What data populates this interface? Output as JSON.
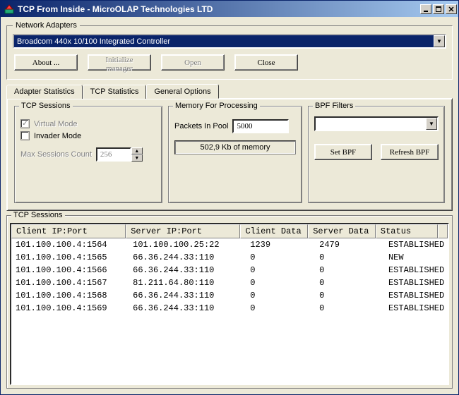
{
  "window": {
    "title": "TCP From Inside - MicroOLAP Technologies LTD"
  },
  "adapters": {
    "legend": "Network Adapters",
    "selected": "Broadcom 440x 10/100 Integrated Controller"
  },
  "buttons": {
    "about": "About ...",
    "init": "Initialize manager",
    "open": "Open",
    "close": "Close"
  },
  "tabs": {
    "adapter": "Adapter Statistics",
    "tcp": "TCP Statistics",
    "general": "General Options"
  },
  "tcpSessionsGroup": {
    "legend": "TCP Sessions",
    "virtualMode": "Virtual Mode",
    "invaderMode": "Invader Mode",
    "maxSessionsLabel": "Max Sessions Count",
    "maxSessionsValue": "256"
  },
  "memoryGroup": {
    "legend": "Memory For Processing",
    "packetsLabel": "Packets In Pool",
    "packetsValue": "5000",
    "memoryText": "502,9 Kb of memory"
  },
  "bpfGroup": {
    "legend": "BPF Filters",
    "selected": "",
    "setBpf": "Set BPF",
    "refreshBpf": "Refresh BPF"
  },
  "sessions": {
    "legend": "TCP Sessions",
    "columns": [
      "Client IP:Port",
      "Server IP:Port",
      "Client Data",
      "Server Data",
      "Status"
    ],
    "rows": [
      {
        "client": "101.100.100.4:1564",
        "server": "101.100.100.25:22",
        "cdata": "1239",
        "sdata": "2479",
        "status": "ESTABLISHED"
      },
      {
        "client": "101.100.100.4:1565",
        "server": "66.36.244.33:110",
        "cdata": "0",
        "sdata": "0",
        "status": "NEW"
      },
      {
        "client": "101.100.100.4:1566",
        "server": "66.36.244.33:110",
        "cdata": "0",
        "sdata": "0",
        "status": "ESTABLISHED"
      },
      {
        "client": "101.100.100.4:1567",
        "server": "81.211.64.80:110",
        "cdata": "0",
        "sdata": "0",
        "status": "ESTABLISHED"
      },
      {
        "client": "101.100.100.4:1568",
        "server": "66.36.244.33:110",
        "cdata": "0",
        "sdata": "0",
        "status": "ESTABLISHED"
      },
      {
        "client": "101.100.100.4:1569",
        "server": "66.36.244.33:110",
        "cdata": "0",
        "sdata": "0",
        "status": "ESTABLISHED"
      }
    ]
  }
}
